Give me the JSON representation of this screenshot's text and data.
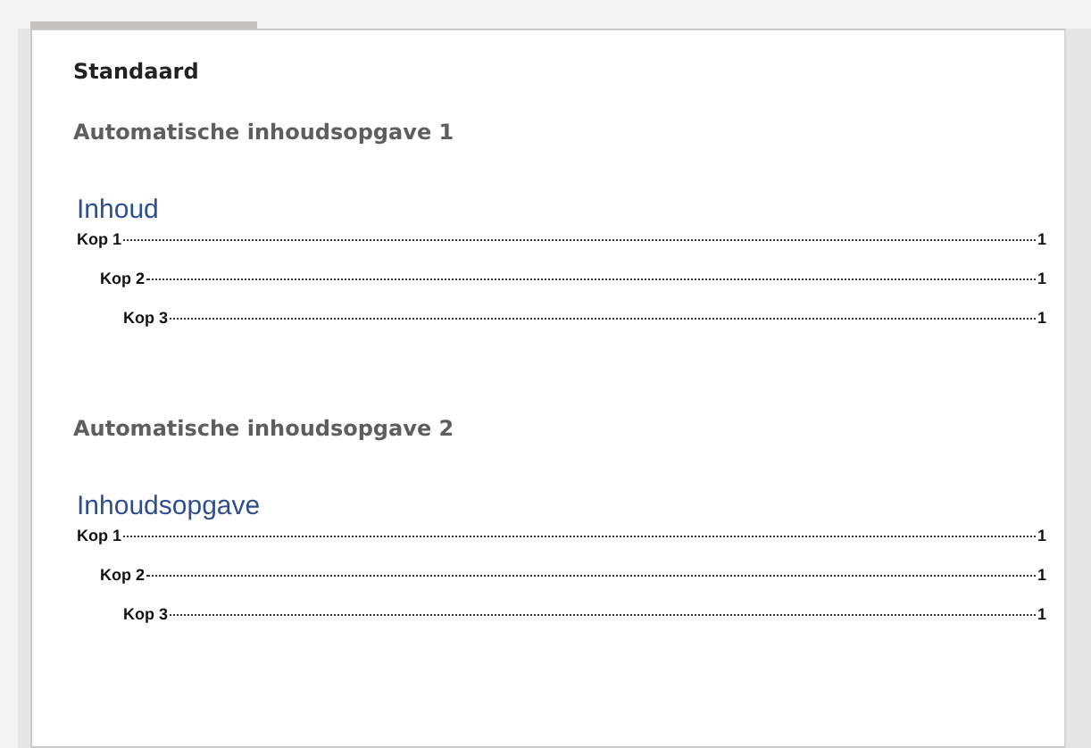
{
  "gallery": {
    "section_title": "Standaard",
    "items": [
      {
        "title": "Automatische inhoudsopgave 1",
        "preview_heading": "Inhoud",
        "entries": [
          {
            "label": "Kop 1",
            "page": "1",
            "children": [
              {
                "label": "Kop 2",
                "page": "1",
                "children": [
                  {
                    "label": "Kop 3",
                    "page": "1"
                  }
                ]
              }
            ]
          }
        ]
      },
      {
        "title": "Automatische inhoudsopgave 2",
        "preview_heading": "Inhoudsopgave",
        "entries": [
          {
            "label": "Kop 1",
            "page": "1",
            "children": [
              {
                "label": "Kop 2",
                "page": "1",
                "children": [
                  {
                    "label": "Kop 3",
                    "page": "1"
                  }
                ]
              }
            ]
          }
        ]
      }
    ]
  }
}
